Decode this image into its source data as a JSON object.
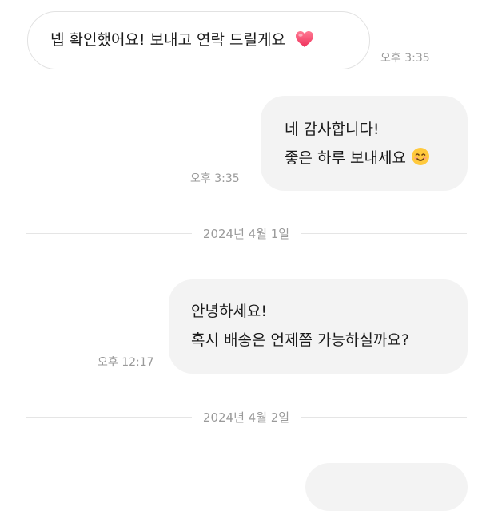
{
  "messages": [
    {
      "direction": "incoming",
      "lines": [
        "넵 확인했어요! 보내고 연락 드릴게요"
      ],
      "emoji": "heart",
      "time": "오후 3:35"
    },
    {
      "direction": "outgoing",
      "lines": [
        "네 감사합니다!",
        "좋은 하루 보내세요"
      ],
      "emoji": "smiling-face",
      "time": "오후 3:35"
    },
    {
      "direction": "outgoing",
      "lines": [
        "안녕하세요!",
        "혹시 배송은 언제쯤 가능하실까요?"
      ],
      "time": "오후 12:17"
    }
  ],
  "date_dividers": [
    "2024년 4월 1일",
    "2024년 4월 2일"
  ],
  "colors": {
    "outgoing_bubble": "#f3f3f3",
    "incoming_border": "#e2e2e2",
    "timestamp": "#9a9a9a",
    "heart": "#ff4d6d"
  }
}
